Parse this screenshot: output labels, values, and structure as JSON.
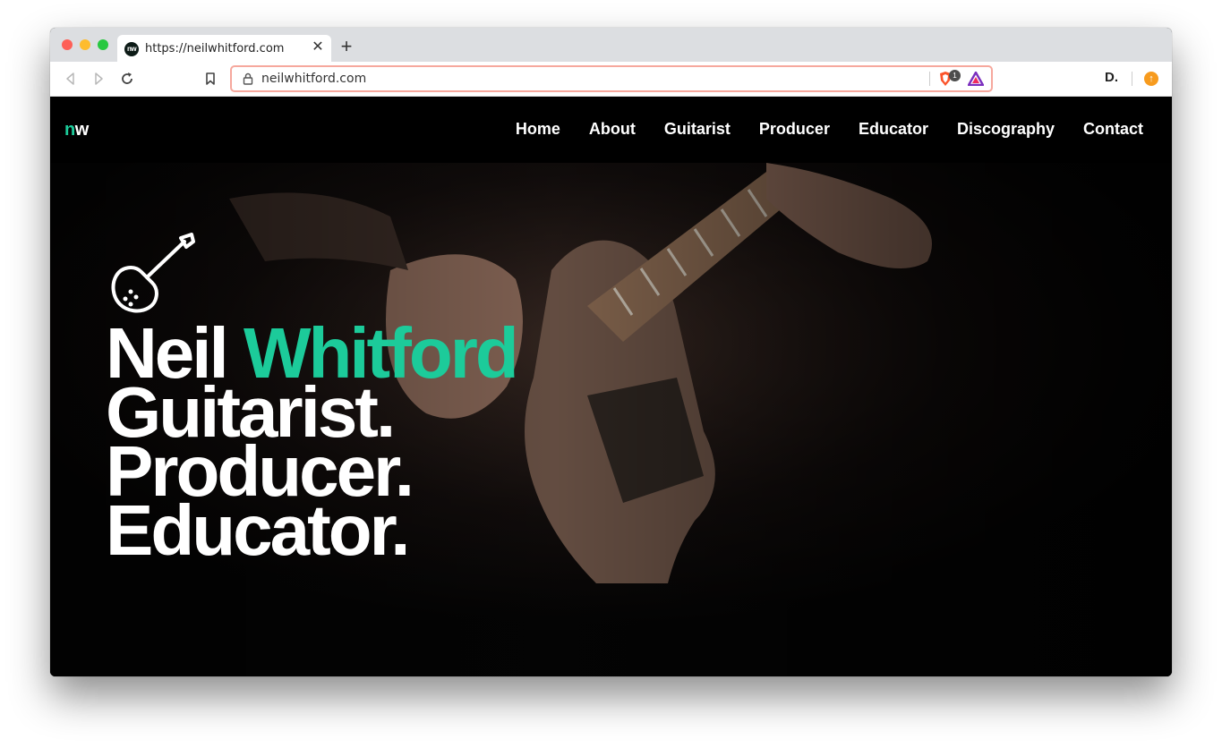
{
  "browser": {
    "tab": {
      "title": "https://neilwhitford.com",
      "favicon_text": "nw"
    },
    "address_bar": {
      "url": "neilwhitford.com"
    },
    "shield_count": "1",
    "toolbar_logo": "D."
  },
  "site": {
    "logo": {
      "part1": "n",
      "part2": "w"
    },
    "nav": [
      "Home",
      "About",
      "Guitarist",
      "Producer",
      "Educator",
      "Discography",
      "Contact"
    ],
    "hero": {
      "first_name": "Neil",
      "last_name": "Whitford",
      "lines": [
        "Guitarist.",
        "Producer.",
        "Educator."
      ]
    }
  },
  "colors": {
    "accent": "#1ccb9a",
    "nav_background": "#000000",
    "url_focus_ring": "#f6a89d"
  },
  "icons": [
    "back-icon",
    "forward-icon",
    "reload-icon",
    "bookmark-icon",
    "lock-icon",
    "brave-shield-icon",
    "brave-rewards-icon",
    "update-icon",
    "guitar-icon"
  ]
}
